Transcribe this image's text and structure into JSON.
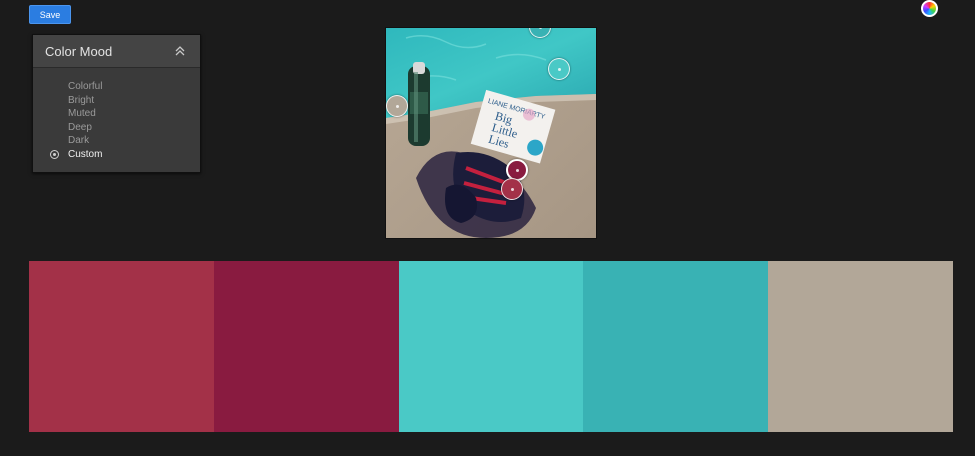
{
  "toolbar": {
    "save_label": "Save",
    "color_wheel_icon": "color-wheel-icon"
  },
  "panel": {
    "title": "Color Mood",
    "collapse_icon": "chevron-up-double-icon",
    "options": [
      {
        "label": "Colorful",
        "selected": false
      },
      {
        "label": "Bright",
        "selected": false
      },
      {
        "label": "Muted",
        "selected": false
      },
      {
        "label": "Deep",
        "selected": false
      },
      {
        "label": "Dark",
        "selected": false
      },
      {
        "label": "Custom",
        "selected": true
      }
    ]
  },
  "photo": {
    "book_author": "LIANE MORIARTY",
    "book_title_lines": [
      "Big",
      "Little",
      "Lies"
    ]
  },
  "palette": {
    "swatches": [
      "#a33148",
      "#891b40",
      "#4ac9c6",
      "#39b2b4",
      "#b2a798"
    ]
  },
  "pickers": [
    {
      "color": "#39b2b4",
      "selected": false
    },
    {
      "color": "#4ac9c6",
      "selected": false
    },
    {
      "color": "#b2a798",
      "selected": false
    },
    {
      "color": "#891b40",
      "selected": true
    },
    {
      "color": "#a33148",
      "selected": false
    }
  ]
}
